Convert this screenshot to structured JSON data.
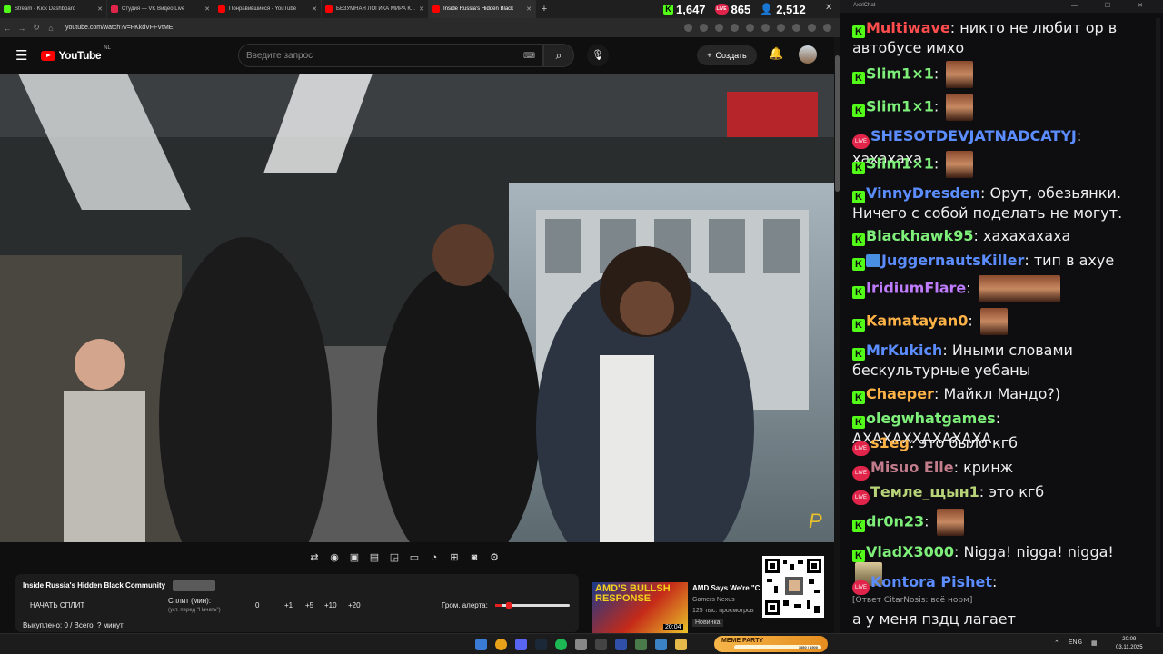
{
  "browser": {
    "tabs": [
      {
        "label": "Stream - Kick Dashboard",
        "color": "#53fc18"
      },
      {
        "label": "Студия — VK Видео Live",
        "color": "#e0244a"
      },
      {
        "label": "Понравившиеся - YouTube",
        "color": "#ff0000"
      },
      {
        "label": "БЕЗУМНАЯ ЛОГИКА МИРА К...",
        "color": "#ff0000"
      },
      {
        "label": "Inside Russia's Hidden Black",
        "color": "#ff0000"
      }
    ],
    "new_tab": "+",
    "url": "youtube.com/watch?v=FKkdVFFVtME",
    "close": "✕"
  },
  "counters": {
    "kick": "1,647",
    "vk": "865",
    "youtube": "2,512",
    "kick_icon": "K",
    "vk_icon": "LIVE"
  },
  "youtube": {
    "logo": "YouTube",
    "region": "NL",
    "search_placeholder": "Введите запрос",
    "create_label": "Создать",
    "keyboard_icon": "⌨"
  },
  "video": {
    "title": "Inside Russia's Hidden Black Community"
  },
  "panel": {
    "start_split": "НАЧАТЬ СПЛИТ",
    "split_label": "Сплит (мин):",
    "split_hint": "(уст. перед \"Начать\")",
    "split_value": "0",
    "plus1": "+1",
    "plus5": "+5",
    "plus10": "+10",
    "plus20": "+20",
    "alert_volume_label": "Гром. алерта:",
    "alert_volume": 0.1,
    "paid_status": "Выкуплено: 0 / Всего: ? минут"
  },
  "recommendation": {
    "thumb_text": "AMD'S BULLSH RESPONSE",
    "duration": "20:04",
    "title": "AMD Says We're \"C",
    "channel": "Gamers Nexus",
    "views": "125 тыс. просмотров",
    "badge": "Новинка"
  },
  "chat": {
    "window_title": "AxelChat",
    "window_buttons": "— ☐ ✕",
    "messages": [
      {
        "platform": "kick",
        "user": "Multiwave",
        "color": "#ff4d4d",
        "text": "никто не любит ор в автобусе имхо"
      },
      {
        "platform": "kick",
        "user": "Slim1×1",
        "color": "#7ef07a",
        "text": "",
        "emote": true
      },
      {
        "platform": "kick",
        "user": "Slim1×1",
        "color": "#7ef07a",
        "text": "",
        "emote": true
      },
      {
        "platform": "vk",
        "user": "SHESOTDEVJATNADCATYJ",
        "color": "#5b8dff",
        "text": "хахахаха"
      },
      {
        "platform": "kick",
        "user": "Slim1×1",
        "color": "#7ef07a",
        "text": "",
        "emote": true
      },
      {
        "platform": "kick",
        "user": "VinnyDresden",
        "color": "#5b8dff",
        "text": "Орут, обезьянки. Ничего с собой поделать не могут."
      },
      {
        "platform": "kick",
        "user": "Blackhawk95",
        "color": "#7ef07a",
        "text": "хахахахаха"
      },
      {
        "platform": "kick",
        "user": "JuggernautsKiller",
        "color": "#5b8dff",
        "text": "тип в ахуе"
      },
      {
        "platform": "kick",
        "user": "IridiumFlare",
        "color": "#c07cff",
        "text": "",
        "emote": true
      },
      {
        "platform": "kick",
        "user": "Kamatayan0",
        "color": "#ffb347",
        "text": "",
        "emote": true
      },
      {
        "platform": "kick",
        "user": "MrKukich",
        "color": "#5b8dff",
        "text": "Иными словами бескультурные уебаны"
      },
      {
        "platform": "kick",
        "user": "Chaeper",
        "color": "#ffb347",
        "text": "Майкл Мандо?)"
      },
      {
        "platform": "kick",
        "user": "olegwhatgames",
        "color": "#7ef07a",
        "text": "АХАХАХХАХАХАХА"
      },
      {
        "platform": "vk",
        "user": "s1eg",
        "color": "#ffb347",
        "text": "это было кгб"
      },
      {
        "platform": "vk",
        "user": "Misuo Elle",
        "color": "#c27c8c",
        "text": "кринж"
      },
      {
        "platform": "vk",
        "user": "Темле_щын1",
        "color": "#b8d479",
        "text": "это кгб"
      },
      {
        "platform": "kick",
        "user": "dr0n23",
        "color": "#7ef07a",
        "text": "",
        "emote": true
      },
      {
        "platform": "kick",
        "user": "VladX3000",
        "color": "#7ef07a",
        "text": "Nigga! nigga! nigga!"
      },
      {
        "platform": "vk",
        "user": "Kontora Pishet",
        "color": "#5b8dff",
        "text": ""
      },
      {
        "reply": "[Ответ CitarNosis: всё норм]"
      },
      {
        "text": "а у меня пздц лагает"
      }
    ]
  },
  "taskbar": {
    "meme_label": "MEME PARTY",
    "meme_progress": "1850 / 1500",
    "lang": "ENG",
    "time": "20:09",
    "date": "03.11.2025"
  }
}
